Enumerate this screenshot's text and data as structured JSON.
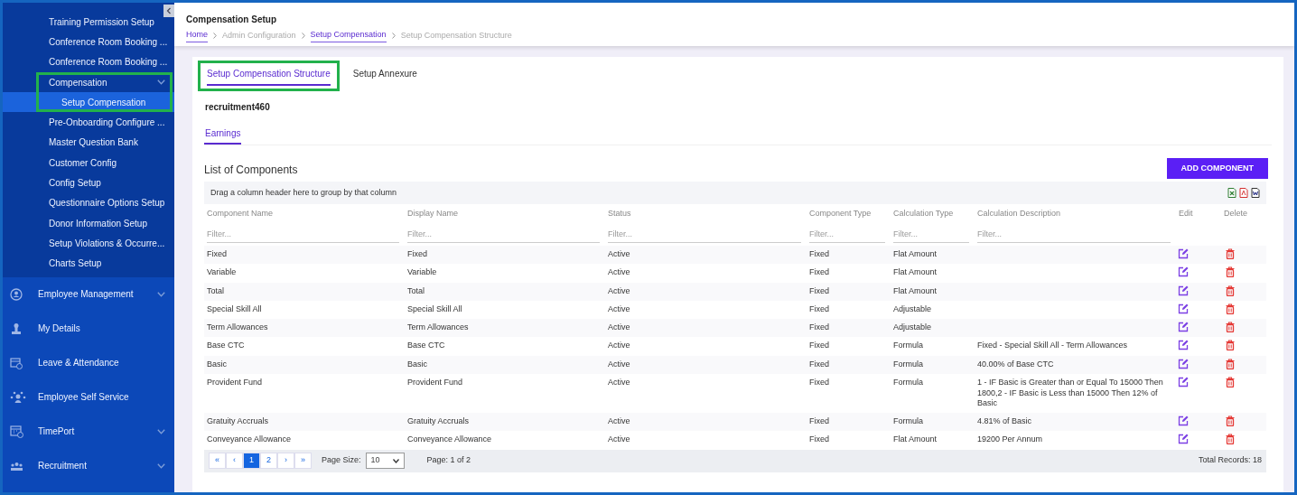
{
  "sidebar": {
    "items": [
      {
        "label": "Training Permission Setup",
        "kind": "link",
        "selected": false
      },
      {
        "label": "Conference Room Booking ...",
        "kind": "link",
        "selected": false
      },
      {
        "label": "Conference Room Booking ...",
        "kind": "link",
        "selected": false
      },
      {
        "label": "Compensation",
        "kind": "group",
        "selected": false,
        "highlighted": true
      },
      {
        "label": "Setup Compensation",
        "kind": "child",
        "selected": true,
        "highlighted": true
      },
      {
        "label": "Pre-Onboarding Configure ...",
        "kind": "link",
        "selected": false
      },
      {
        "label": "Master Question Bank",
        "kind": "link",
        "selected": false
      },
      {
        "label": "Customer Config",
        "kind": "link",
        "selected": false
      },
      {
        "label": "Config Setup",
        "kind": "link",
        "selected": false
      },
      {
        "label": "Questionnaire Options Setup",
        "kind": "link",
        "selected": false
      },
      {
        "label": "Donor Information Setup",
        "kind": "link",
        "selected": false
      },
      {
        "label": "Setup Violations & Occurre...",
        "kind": "link",
        "selected": false
      },
      {
        "label": "Charts Setup",
        "kind": "link",
        "selected": false
      },
      {
        "label": "Employee Management",
        "kind": "section",
        "selected": false,
        "has_submenu": true
      },
      {
        "label": "My Details",
        "kind": "section",
        "selected": false,
        "has_submenu": false
      },
      {
        "label": "Leave & Attendance",
        "kind": "section",
        "selected": false,
        "has_submenu": false
      },
      {
        "label": "Employee Self Service",
        "kind": "section",
        "selected": false,
        "has_submenu": false
      },
      {
        "label": "TimePort",
        "kind": "section",
        "selected": false,
        "has_submenu": true
      },
      {
        "label": "Recruitment",
        "kind": "section",
        "selected": false,
        "has_submenu": true
      }
    ]
  },
  "header": {
    "title": "Compensation Setup",
    "breadcrumb": [
      {
        "label": "Home",
        "link": true
      },
      {
        "label": "Admin Configuration",
        "link": false
      },
      {
        "label": "Setup Compensation",
        "link": true
      },
      {
        "label": "Setup Compensation Structure",
        "link": false
      }
    ]
  },
  "tabs": [
    {
      "label": "Setup Compensation Structure",
      "selected": true,
      "highlighted": true
    },
    {
      "label": "Setup Annexure",
      "selected": false,
      "highlighted": false
    }
  ],
  "structure_name": "recruitment460",
  "subtabs": [
    {
      "label": "Earnings",
      "selected": true
    }
  ],
  "list_title": "List of Components",
  "add_button": "ADD COMPONENT",
  "group_panel": "Drag a column header here to group by that column",
  "table": {
    "columns": [
      {
        "label": "Component Name",
        "placeholder": "Filter..."
      },
      {
        "label": "Display Name",
        "placeholder": "Filter..."
      },
      {
        "label": "Status",
        "placeholder": "Filter..."
      },
      {
        "label": "Component Type",
        "placeholder": "Filter..."
      },
      {
        "label": "Calculation Type",
        "placeholder": "Filter..."
      },
      {
        "label": "Calculation Description",
        "placeholder": "Filter..."
      },
      {
        "label": "Edit"
      },
      {
        "label": "Delete"
      }
    ],
    "rows": [
      [
        "Fixed",
        "Fixed",
        "Active",
        "Fixed",
        "Flat Amount",
        ""
      ],
      [
        "Variable",
        "Variable",
        "Active",
        "Fixed",
        "Flat Amount",
        ""
      ],
      [
        "Total",
        "Total",
        "Active",
        "Fixed",
        "Flat Amount",
        ""
      ],
      [
        "Special Skill All",
        "Special Skill All",
        "Active",
        "Fixed",
        "Adjustable",
        ""
      ],
      [
        "Term Allowances",
        "Term Allowances",
        "Active",
        "Fixed",
        "Adjustable",
        ""
      ],
      [
        "Base CTC",
        "Base CTC",
        "Active",
        "Fixed",
        "Formula",
        "Fixed - Special Skill All - Term Allowances"
      ],
      [
        "Basic",
        "Basic",
        "Active",
        "Fixed",
        "Formula",
        "40.00% of Base CTC"
      ],
      [
        "Provident Fund",
        "Provident Fund",
        "Active",
        "Fixed",
        "Formula",
        "1 - IF Basic is Greater than or Equal To 15000 Then 1800,2 - IF Basic is Less than 15000 Then 12% of Basic"
      ],
      [
        "Gratuity Accruals",
        "Gratuity Accruals",
        "Active",
        "Fixed",
        "Formula",
        "4.81% of Basic"
      ],
      [
        "Conveyance Allowance",
        "Conveyance Allowance",
        "Active",
        "Fixed",
        "Flat Amount",
        "19200 Per Annum"
      ]
    ]
  },
  "pager": {
    "buttons": [
      {
        "label": "«",
        "selected": false
      },
      {
        "label": "‹",
        "selected": false
      },
      {
        "label": "1",
        "selected": true
      },
      {
        "label": "2",
        "selected": false
      },
      {
        "label": "›",
        "selected": false
      },
      {
        "label": "»",
        "selected": false
      }
    ],
    "page_size_label": "Page Size:",
    "page_size": "10",
    "page_info": "Page: 1 of 2",
    "total": "Total Records: 18"
  }
}
